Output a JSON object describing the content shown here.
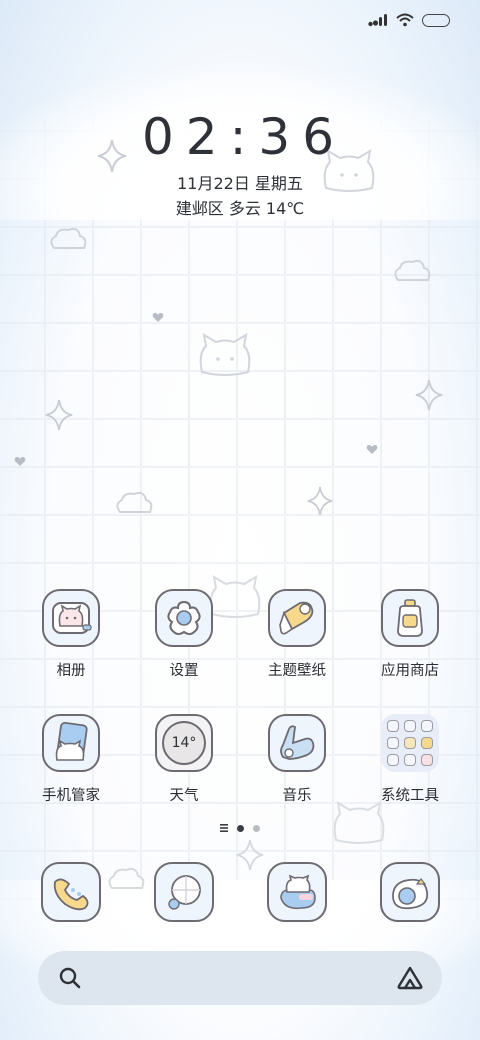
{
  "status_bar": {
    "icons": [
      "signal-icon",
      "wifi-icon",
      "battery-icon"
    ]
  },
  "clock": {
    "time": "02:36",
    "date": "11月22日 星期五",
    "weather": "建邺区 多云 14℃"
  },
  "apps_row1": [
    {
      "label": "相册",
      "icon": "photo-album-icon"
    },
    {
      "label": "设置",
      "icon": "settings-flower-icon"
    },
    {
      "label": "主题壁纸",
      "icon": "theme-icecream-icon"
    },
    {
      "label": "应用商店",
      "icon": "app-store-bottle-icon"
    }
  ],
  "apps_row2": [
    {
      "label": "手机管家",
      "icon": "phone-manager-icon"
    },
    {
      "label": "天气",
      "icon": "weather-icon",
      "badge": "14°"
    },
    {
      "label": "音乐",
      "icon": "music-icon"
    },
    {
      "label": "系统工具",
      "icon": "folder-icon"
    }
  ],
  "dock": [
    {
      "icon": "phone-icon"
    },
    {
      "icon": "browser-icon"
    },
    {
      "icon": "messages-icon"
    },
    {
      "icon": "camera-icon"
    }
  ],
  "colors": {
    "icon_border": "#6e6a72",
    "icon_bg": "#eef5fd",
    "accent_blue": "#a9cdf0",
    "accent_yellow": "#f6d98a",
    "search_bg": "#dde5ee"
  }
}
